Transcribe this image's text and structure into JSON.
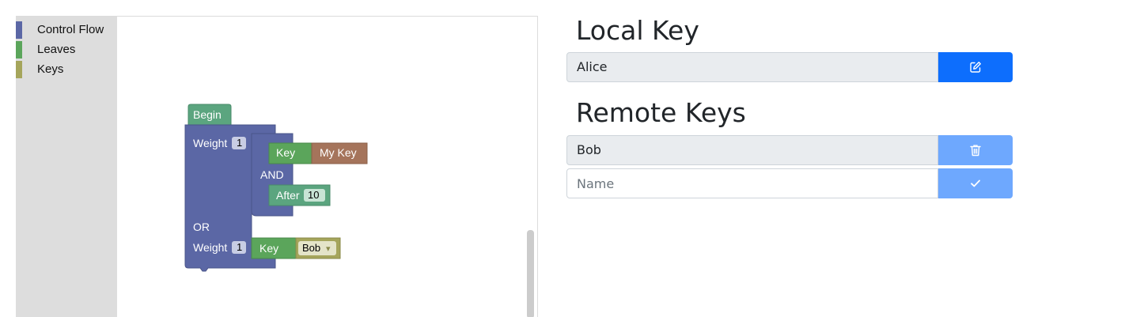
{
  "toolbox": {
    "categories": [
      {
        "label": "Control Flow",
        "color": "#5b67a5"
      },
      {
        "label": "Leaves",
        "color": "#5ba55b"
      },
      {
        "label": "Keys",
        "color": "#a5a55b"
      }
    ]
  },
  "blocks": {
    "begin": "Begin",
    "weight_label": "Weight",
    "weight_1_value": "1",
    "and_label": "AND",
    "or_label": "OR",
    "weight_2_value": "1",
    "key_label_1": "Key",
    "my_key_label": "My Key",
    "after_label": "After",
    "after_value": "10",
    "key_label_2": "Key",
    "bob_dropdown": "Bob",
    "dropdown_arrow": "▾",
    "colors": {
      "control_flow": "#5b67a5",
      "leaf": "#5ba55b",
      "begin": "#5ba57f",
      "key_ref": "#a5745b",
      "key_dropdown": "#a5a55b"
    }
  },
  "local_key": {
    "heading": "Local Key",
    "value": "Alice",
    "edit_button_icon": "edit-icon"
  },
  "remote_keys": {
    "heading": "Remote Keys",
    "items": [
      {
        "value": "Bob",
        "delete_button_icon": "trash-icon"
      }
    ],
    "new_key": {
      "value": "",
      "placeholder": "Name",
      "confirm_button_icon": "check-icon"
    }
  }
}
